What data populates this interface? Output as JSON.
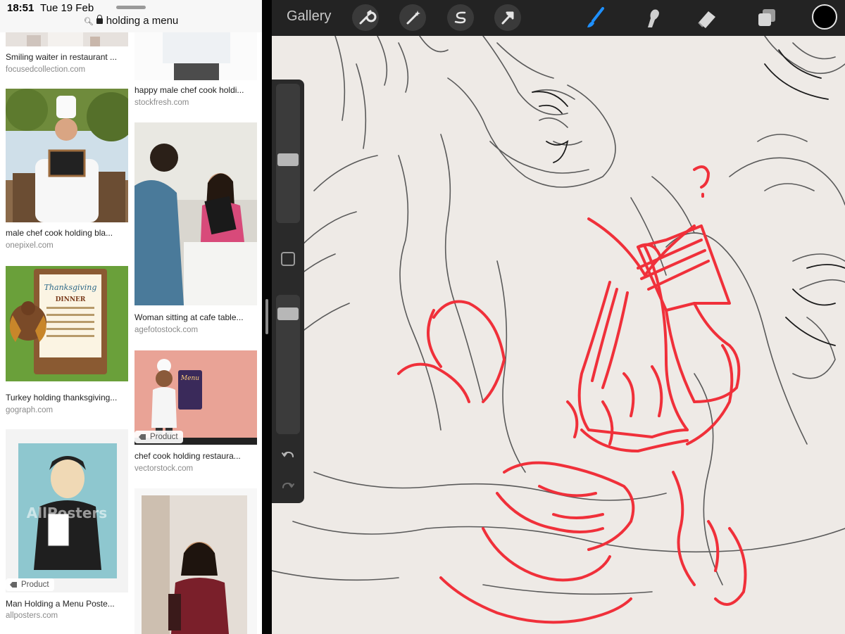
{
  "status_bar": {
    "time": "18:51",
    "date": "Tue 19 Feb"
  },
  "browser": {
    "url_text": "holding a menu"
  },
  "results": {
    "col1": [
      {
        "title": "Smiling waiter in restaurant ...",
        "source": "focusedcollection.com"
      },
      {
        "title": "male chef cook holding bla...",
        "source": "onepixel.com"
      },
      {
        "title": "Turkey holding thanksgiving...",
        "source": "gograph.com",
        "thumb_text": {
          "heading": "Thanksgiving",
          "sub": "DINNER"
        }
      },
      {
        "title": "Man Holding a Menu Poste...",
        "source": "allposters.com",
        "badge": "Product",
        "thumb_text": {
          "watermark": "AllPosters"
        }
      }
    ],
    "col2": [
      {
        "title": "happy male chef cook holdi...",
        "source": "stockfresh.com"
      },
      {
        "title": "Woman sitting at cafe table...",
        "source": "agefotostock.com"
      },
      {
        "title": "chef cook holding restaura...",
        "source": "vectorstock.com",
        "badge": "Product",
        "thumb_text": {
          "menu": "Menu"
        }
      },
      {
        "title": "",
        "source": ""
      }
    ]
  },
  "procreate": {
    "gallery_label": "Gallery",
    "tools": [
      "wrench-icon",
      "magic-wand-icon",
      "selection-icon",
      "transform-arrow-icon",
      "brush-icon",
      "smudge-icon",
      "eraser-icon",
      "layers-icon"
    ],
    "active_tool": "brush",
    "current_color": "#000000",
    "brush_size_level": 0.45,
    "opacity_level": 0.9
  },
  "colors": {
    "sketch_red": "#f0303a",
    "sketch_grey": "#555555",
    "brush_active": "#1e90ff",
    "canvas_bg": "#eeeae6"
  }
}
